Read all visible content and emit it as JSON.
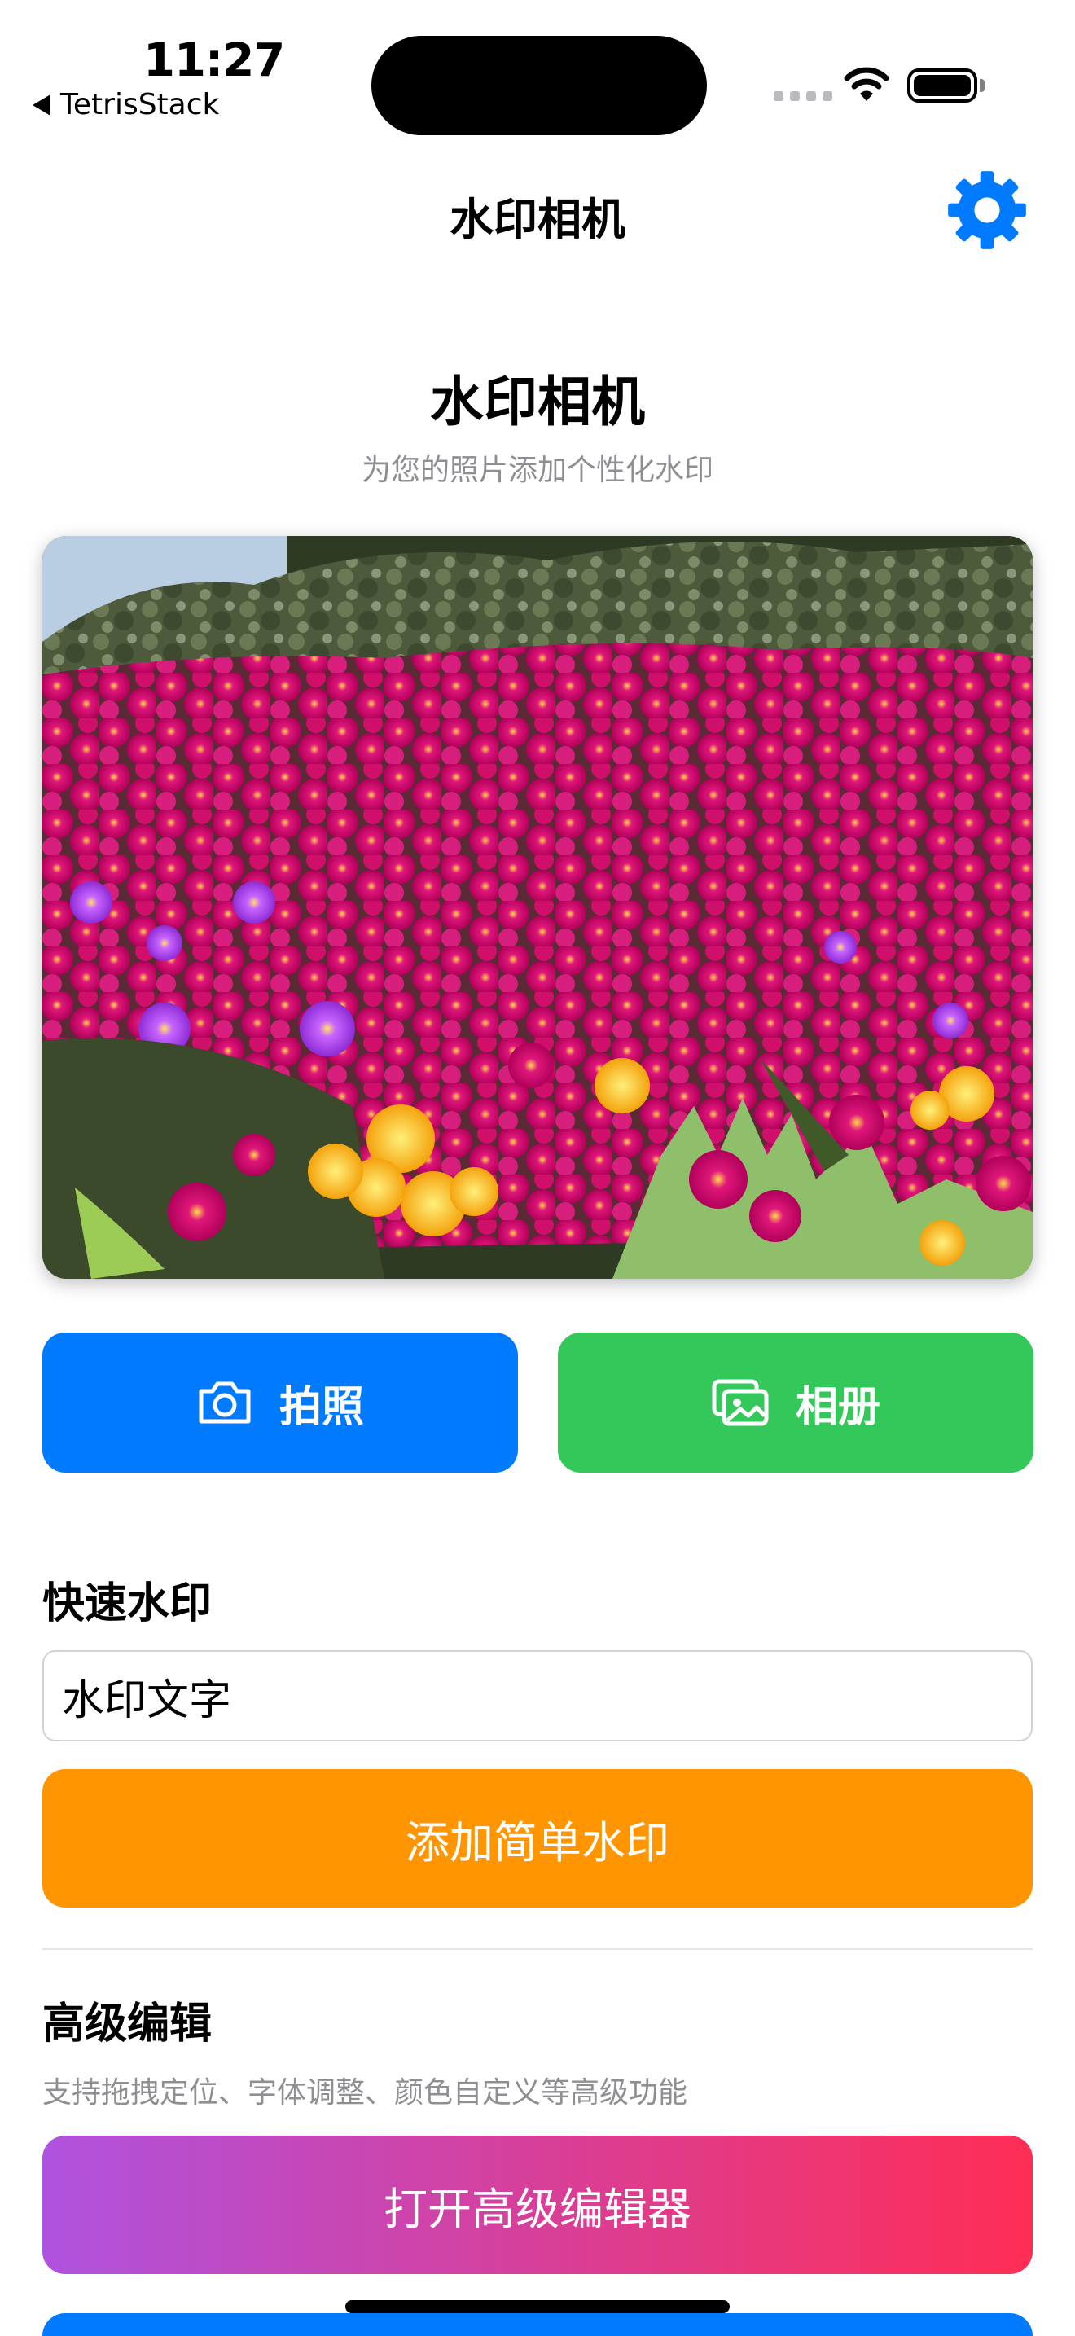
{
  "status_bar": {
    "time": "11:27",
    "back_app": "TetrisStack",
    "icons": [
      "signal-icon",
      "wifi-icon",
      "battery-icon"
    ]
  },
  "nav": {
    "title": "水印相机",
    "settings_icon": "gear-icon"
  },
  "header": {
    "title": "水印相机",
    "subtitle": "为您的照片添加个性化水印"
  },
  "photo": {
    "description_icon": "photo-preview"
  },
  "actions": {
    "camera_label": "拍照",
    "album_label": "相册",
    "camera_color": "#007aff",
    "album_color": "#34c759"
  },
  "quick": {
    "title": "快速水印",
    "input_value": "水印文字",
    "button_label": "添加简单水印",
    "button_color": "#ff9500"
  },
  "advanced": {
    "title": "高级编辑",
    "description": "支持拖拽定位、字体调整、颜色自定义等高级功能",
    "button_label": "打开高级编辑器",
    "gradient": [
      "#af52de",
      "#ff2d55"
    ]
  }
}
